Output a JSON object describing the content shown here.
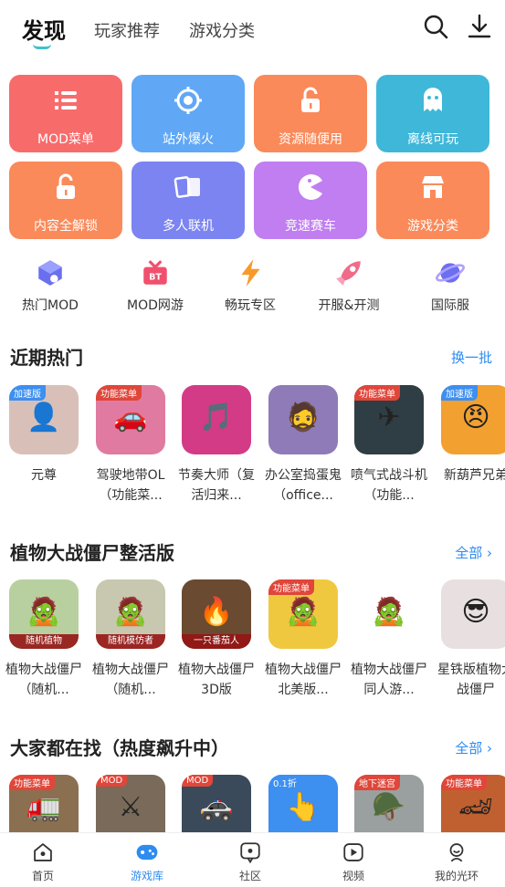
{
  "header": {
    "tabs": [
      {
        "label": "发现",
        "active": true
      },
      {
        "label": "玩家推荐"
      },
      {
        "label": "游戏分类"
      }
    ],
    "icons": [
      "search-icon",
      "download-icon"
    ]
  },
  "features": [
    {
      "label": "MOD菜单",
      "color": "#f86b6b",
      "icon": "list-icon"
    },
    {
      "label": "站外爆火",
      "color": "#60a8f5",
      "icon": "target-icon"
    },
    {
      "label": "资源随便用",
      "color": "#fa8a5a",
      "icon": "unlock-icon"
    },
    {
      "label": "离线可玩",
      "color": "#3fb7d9",
      "icon": "ghost-icon"
    },
    {
      "label": "内容全解锁",
      "color": "#fa8a5a",
      "icon": "unlock-icon"
    },
    {
      "label": "多人联机",
      "color": "#7b84f0",
      "icon": "cards-icon"
    },
    {
      "label": "竞速赛车",
      "color": "#c07ef0",
      "icon": "pacman-icon"
    },
    {
      "label": "游戏分类",
      "color": "#fa8a5a",
      "icon": "store-icon"
    }
  ],
  "quick": [
    {
      "label": "热门MOD",
      "icon": "mod-cube-icon",
      "color": "#6a6ff0"
    },
    {
      "label": "MOD网游",
      "icon": "bt-gift-icon",
      "color": "#f0506e"
    },
    {
      "label": "畅玩专区",
      "icon": "lightning-icon",
      "color": "#f79a2a"
    },
    {
      "label": "开服&开测",
      "icon": "rocket-icon",
      "color": "#f06b8a"
    },
    {
      "label": "国际服",
      "icon": "planet-icon",
      "color": "#6b6ff0"
    }
  ],
  "sections": [
    {
      "title": "近期热门",
      "link": "换一批",
      "apps": [
        {
          "name": "元尊",
          "badge": "加速版",
          "badge_color": "#3d8ff0",
          "bg": "#d8c0b8",
          "glyph": "👤"
        },
        {
          "name": "驾驶地带OL（功能菜...",
          "badge": "功能菜单",
          "badge_color": "#e0463a",
          "bg": "#e07aa0",
          "glyph": "🚗"
        },
        {
          "name": "节奏大师（复活归来...",
          "badge": "",
          "badge_color": "",
          "bg": "#d33b86",
          "glyph": "🎵"
        },
        {
          "name": "办公室捣蛋鬼（office...",
          "badge": "",
          "badge_color": "",
          "bg": "#8e7bb8",
          "glyph": "🧔"
        },
        {
          "name": "喷气式战斗机（功能...",
          "badge": "功能菜单",
          "badge_color": "#e0463a",
          "bg": "#2f3d44",
          "glyph": "✈"
        },
        {
          "name": "新葫芦兄弟",
          "badge": "加速版",
          "badge_color": "#3d8ff0",
          "bg": "#f2a030",
          "glyph": "😠"
        }
      ]
    },
    {
      "title": "植物大战僵尸整活版",
      "link": "全部",
      "apps": [
        {
          "name": "植物大战僵尸（随机...",
          "badge": "",
          "badge_color": "",
          "bg": "#b8d0a0",
          "glyph": "🧟",
          "tag": "随机植物"
        },
        {
          "name": "植物大战僵尸（随机...",
          "badge": "",
          "badge_color": "",
          "bg": "#c8c8b0",
          "glyph": "🧟",
          "tag": "随机模仿者"
        },
        {
          "name": "植物大战僵尸3D版",
          "badge": "",
          "badge_color": "",
          "bg": "#6a4a30",
          "glyph": "🔥",
          "tag": "一只番茄人"
        },
        {
          "name": "植物大战僵尸北美版...",
          "badge": "功能菜单",
          "badge_color": "#e0463a",
          "bg": "#f0c840",
          "glyph": "🧟"
        },
        {
          "name": "植物大战僵尸同人游...",
          "badge": "",
          "badge_color": "",
          "bg": "#ffffff",
          "glyph": "🧟"
        },
        {
          "name": "星铁版植物大战僵尸",
          "badge": "",
          "badge_color": "",
          "bg": "#e8e0e0",
          "glyph": "😎"
        }
      ]
    },
    {
      "title": "大家都在找（热度飙升中）",
      "link": "全部",
      "apps": [
        {
          "name": "",
          "badge": "功能菜单",
          "badge_color": "#e0463a",
          "bg": "#8a7050",
          "glyph": "🚛"
        },
        {
          "name": "",
          "badge": "MOD",
          "badge_color": "#e0463a",
          "bg": "#7a6a5a",
          "glyph": "⚔"
        },
        {
          "name": "",
          "badge": "MOD",
          "badge_color": "#e0463a",
          "bg": "#3a4a5a",
          "glyph": "🚓"
        },
        {
          "name": "",
          "badge": "0.1折",
          "badge_color": "#3d8ff0",
          "bg": "#3d8ff0",
          "glyph": "👆"
        },
        {
          "name": "",
          "badge": "地下迷宫",
          "badge_color": "#e0463a",
          "bg": "#9aa0a0",
          "glyph": "🪖"
        },
        {
          "name": "",
          "badge": "功能菜单",
          "badge_color": "#e0463a",
          "bg": "#c06030",
          "glyph": "🏎"
        }
      ]
    }
  ],
  "nav": [
    {
      "label": "首页",
      "icon": "home-icon",
      "active": false
    },
    {
      "label": "游戏库",
      "icon": "gamepad-icon",
      "active": true
    },
    {
      "label": "社区",
      "icon": "community-icon",
      "active": false
    },
    {
      "label": "视频",
      "icon": "video-icon",
      "active": false
    },
    {
      "label": "我的光环",
      "icon": "profile-icon",
      "active": false
    }
  ]
}
